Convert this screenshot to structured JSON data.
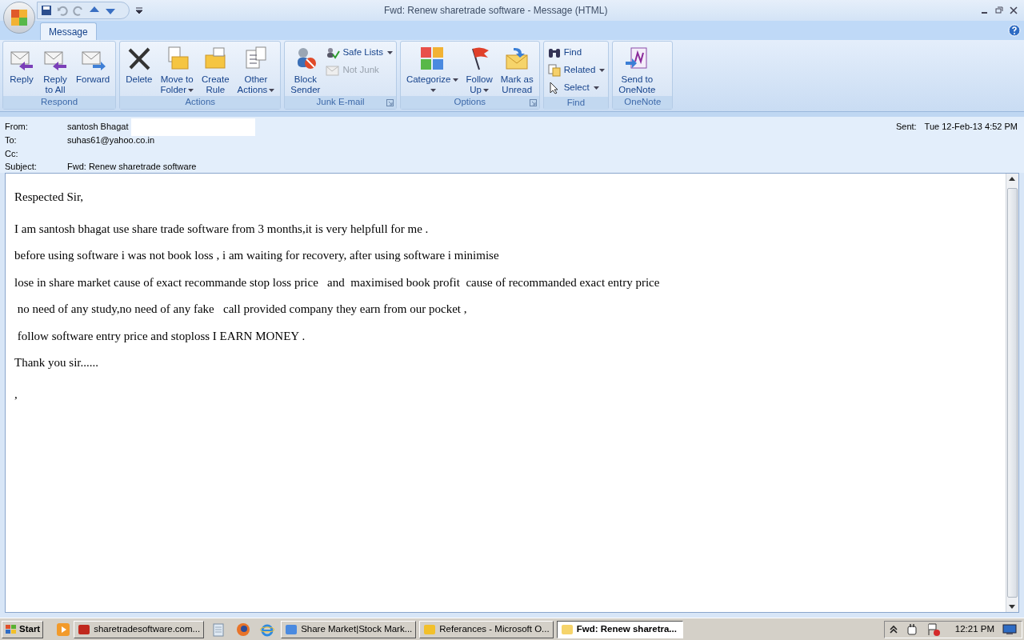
{
  "window": {
    "title": "Fwd: Renew sharetrade software - Message (HTML)"
  },
  "tabs": [
    {
      "label": "Message",
      "selected": true
    }
  ],
  "ribbon_groups": [
    {
      "label": "Respond",
      "launcher": false,
      "buttons": [
        {
          "kind": "large",
          "lines": [
            "Reply"
          ],
          "dropdown": false,
          "disabled": false
        },
        {
          "kind": "large",
          "lines": [
            "Reply",
            "to All"
          ],
          "dropdown": false,
          "disabled": false
        },
        {
          "kind": "large",
          "lines": [
            "Forward"
          ],
          "dropdown": false,
          "disabled": false
        }
      ]
    },
    {
      "label": "Actions",
      "launcher": false,
      "buttons": [
        {
          "kind": "large",
          "lines": [
            "Delete"
          ],
          "dropdown": false,
          "disabled": false
        },
        {
          "kind": "large",
          "lines": [
            "Move to",
            "Folder"
          ],
          "dropdown": true,
          "disabled": false
        },
        {
          "kind": "large",
          "lines": [
            "Create",
            "Rule"
          ],
          "dropdown": false,
          "disabled": false
        },
        {
          "kind": "large",
          "lines": [
            "Other",
            "Actions"
          ],
          "dropdown": true,
          "disabled": false
        }
      ]
    },
    {
      "label": "Junk E-mail",
      "launcher": true,
      "buttons": [
        {
          "kind": "large",
          "lines": [
            "Block",
            "Sender"
          ],
          "dropdown": false,
          "disabled": false
        },
        {
          "kind": "small",
          "lines": [
            "Safe Lists"
          ],
          "dropdown": true,
          "disabled": false
        },
        {
          "kind": "small",
          "lines": [
            "Not Junk"
          ],
          "dropdown": false,
          "disabled": true
        }
      ]
    },
    {
      "label": "Options",
      "launcher": true,
      "buttons": [
        {
          "kind": "large",
          "lines": [
            "Categorize"
          ],
          "dropdown": true,
          "disabled": false
        },
        {
          "kind": "large",
          "lines": [
            "Follow",
            "Up"
          ],
          "dropdown": true,
          "disabled": false
        },
        {
          "kind": "large",
          "lines": [
            "Mark as",
            "Unread"
          ],
          "dropdown": false,
          "disabled": false
        }
      ]
    },
    {
      "label": "Find",
      "launcher": false,
      "buttons": [
        {
          "kind": "small",
          "lines": [
            "Find"
          ],
          "dropdown": false,
          "disabled": false
        },
        {
          "kind": "small",
          "lines": [
            "Related"
          ],
          "dropdown": true,
          "disabled": false
        },
        {
          "kind": "small",
          "lines": [
            "Select"
          ],
          "dropdown": true,
          "disabled": false
        }
      ]
    },
    {
      "label": "OneNote",
      "launcher": false,
      "buttons": [
        {
          "kind": "large",
          "lines": [
            "Send to",
            "OneNote"
          ],
          "dropdown": false,
          "disabled": false
        }
      ]
    }
  ],
  "header": {
    "fields": [
      {
        "label": "From:",
        "value": "santosh Bhagat",
        "redacted": true
      },
      {
        "label": "To:",
        "value": "suhas61@yahoo.co.in"
      },
      {
        "label": "Cc:"
      },
      {
        "label": "Subject:",
        "value": "Fwd: Renew sharetrade software"
      }
    ],
    "sent": {
      "label": "Sent:",
      "value": "Tue 12-Feb-13 4:52 PM"
    }
  },
  "body": [
    "Respected Sir,",
    "I am santosh bhagat use share trade software from 3 months,it is very helpfull for me .",
    "before using software i was not book loss , i am waiting for recovery, after using software i minimise",
    "lose in share market cause of exact recommande stop loss price   and  maximised book profit  cause of recommanded exact entry price",
    " no need of any study,no need of any fake   call provided company they earn from our pocket ,",
    " follow software entry price and stoploss I EARN MONEY .",
    "Thank you sir......",
    ","
  ],
  "taskbar": {
    "start": "Start",
    "items": [
      {
        "label": "sharetradesoftware.com...",
        "selected": false
      },
      {
        "label": "Share Market|Stock Mark...",
        "selected": false
      },
      {
        "label": "Referances - Microsoft O...",
        "selected": false
      },
      {
        "label": "Fwd: Renew sharetra...",
        "selected": true
      }
    ],
    "clock": "12:21 PM"
  }
}
